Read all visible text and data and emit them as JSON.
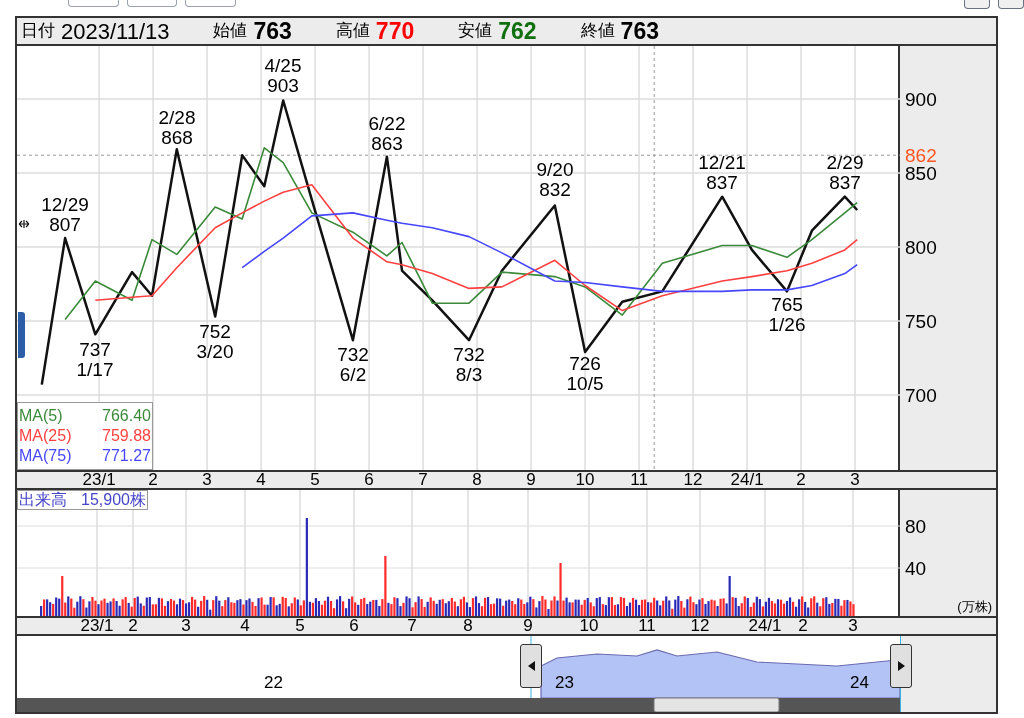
{
  "header": {
    "date_label": "日付",
    "date": "2023/11/13",
    "fields": [
      {
        "label": "始値",
        "value": "763",
        "color": "#000000"
      },
      {
        "label": "高値",
        "value": "770",
        "color": "#ff0000"
      },
      {
        "label": "安値",
        "value": "762",
        "color": "#107010"
      },
      {
        "label": "終値",
        "value": "763",
        "color": "#000000"
      }
    ]
  },
  "price_chart": {
    "annotations": [
      {
        "kind": "peak",
        "date": "12/29",
        "price": "807"
      },
      {
        "kind": "trough",
        "date": "1/17",
        "price": "737"
      },
      {
        "kind": "peak",
        "date": "2/28",
        "price": "868"
      },
      {
        "kind": "trough",
        "date": "3/20",
        "price": "752"
      },
      {
        "kind": "peak",
        "date": "4/25",
        "price": "903"
      },
      {
        "kind": "trough",
        "date": "6/2",
        "price": "732"
      },
      {
        "kind": "peak",
        "date": "6/22",
        "price": "863"
      },
      {
        "kind": "trough",
        "date": "8/3",
        "price": "732"
      },
      {
        "kind": "peak",
        "date": "9/20",
        "price": "832"
      },
      {
        "kind": "trough",
        "date": "10/5",
        "price": "726"
      },
      {
        "kind": "peak",
        "date": "12/21",
        "price": "837"
      },
      {
        "kind": "trough",
        "date": "1/26",
        "price": "765"
      },
      {
        "kind": "peak",
        "date": "2/29",
        "price": "837"
      }
    ],
    "ma_values": [
      "766.40",
      "759.88",
      "771.27"
    ],
    "months_after": [
      "2",
      "3"
    ],
    "chart_data": {
      "type": "line",
      "x": [
        -0.06,
        0.37,
        0.93,
        1.61,
        1.98,
        2.44,
        3.15,
        3.65,
        4.06,
        4.41,
        4.94,
        5.7,
        6.33,
        6.61,
        7.17,
        7.85,
        8.46,
        9.44,
        10.0,
        10.69,
        11.43,
        12.54,
        13.09,
        13.74,
        14.2,
        14.81,
        15.04
      ],
      "series": [
        {
          "color": "#111111",
          "values": [
            707,
            806,
            741,
            783,
            767,
            866,
            753,
            862,
            841,
            899,
            832,
            737,
            861,
            784,
            764,
            737,
            784,
            828,
            729,
            763,
            770,
            834,
            798,
            770,
            811,
            834,
            825
          ]
        },
        {
          "name": "MA(5)",
          "color": "#3a8a3a",
          "values": [
            null,
            751,
            777,
            764,
            805,
            795,
            827,
            819,
            867,
            857,
            823,
            810,
            794,
            803,
            762,
            762,
            783,
            780,
            773,
            754,
            789,
            801,
            801,
            793,
            805,
            823,
            830
          ]
        },
        {
          "name": "MA(25)",
          "color": "#ff4040",
          "values": [
            null,
            null,
            764,
            766,
            767,
            786,
            813,
            823,
            831,
            837,
            842,
            806,
            790,
            788,
            782,
            772,
            773,
            791,
            774,
            757,
            767,
            777,
            780,
            784,
            789,
            798,
            805
          ]
        },
        {
          "name": "MA(75)",
          "color": "#4646ff",
          "values": [
            null,
            null,
            null,
            null,
            null,
            null,
            null,
            786,
            797,
            806,
            821,
            823,
            818,
            816,
            813,
            807,
            796,
            777,
            776,
            773,
            770,
            770,
            771,
            771,
            774,
            782,
            788
          ]
        }
      ],
      "xlim": [
        -0.52,
        17.61
      ],
      "ylim": [
        649.3,
        935.8
      ],
      "grid": true,
      "ref_lines": [
        {
          "axis": "y",
          "value": 862,
          "label": "862"
        },
        {
          "axis": "x",
          "value": 11.28
        }
      ],
      "xticks": [
        {
          "value": 1,
          "label": "23/1"
        },
        2,
        3,
        4,
        5,
        6,
        7,
        8,
        9,
        10,
        11,
        12,
        {
          "value": 13,
          "label": "24/1"
        }
      ],
      "yticks": [
        900,
        850,
        800,
        750,
        700
      ]
    }
  },
  "volume_chart": {
    "label": "出来高",
    "value": "15,900株",
    "y_axis": [
      "80",
      "40"
    ],
    "unit": "(万株)",
    "months": [
      "23/1",
      "2",
      "3",
      "4",
      "5",
      "6",
      "7",
      "8",
      "9",
      "10",
      "11",
      "12",
      "24/1",
      "2",
      "3"
    ]
  },
  "navigator": {
    "years": [
      "22",
      "23",
      "24"
    ]
  }
}
